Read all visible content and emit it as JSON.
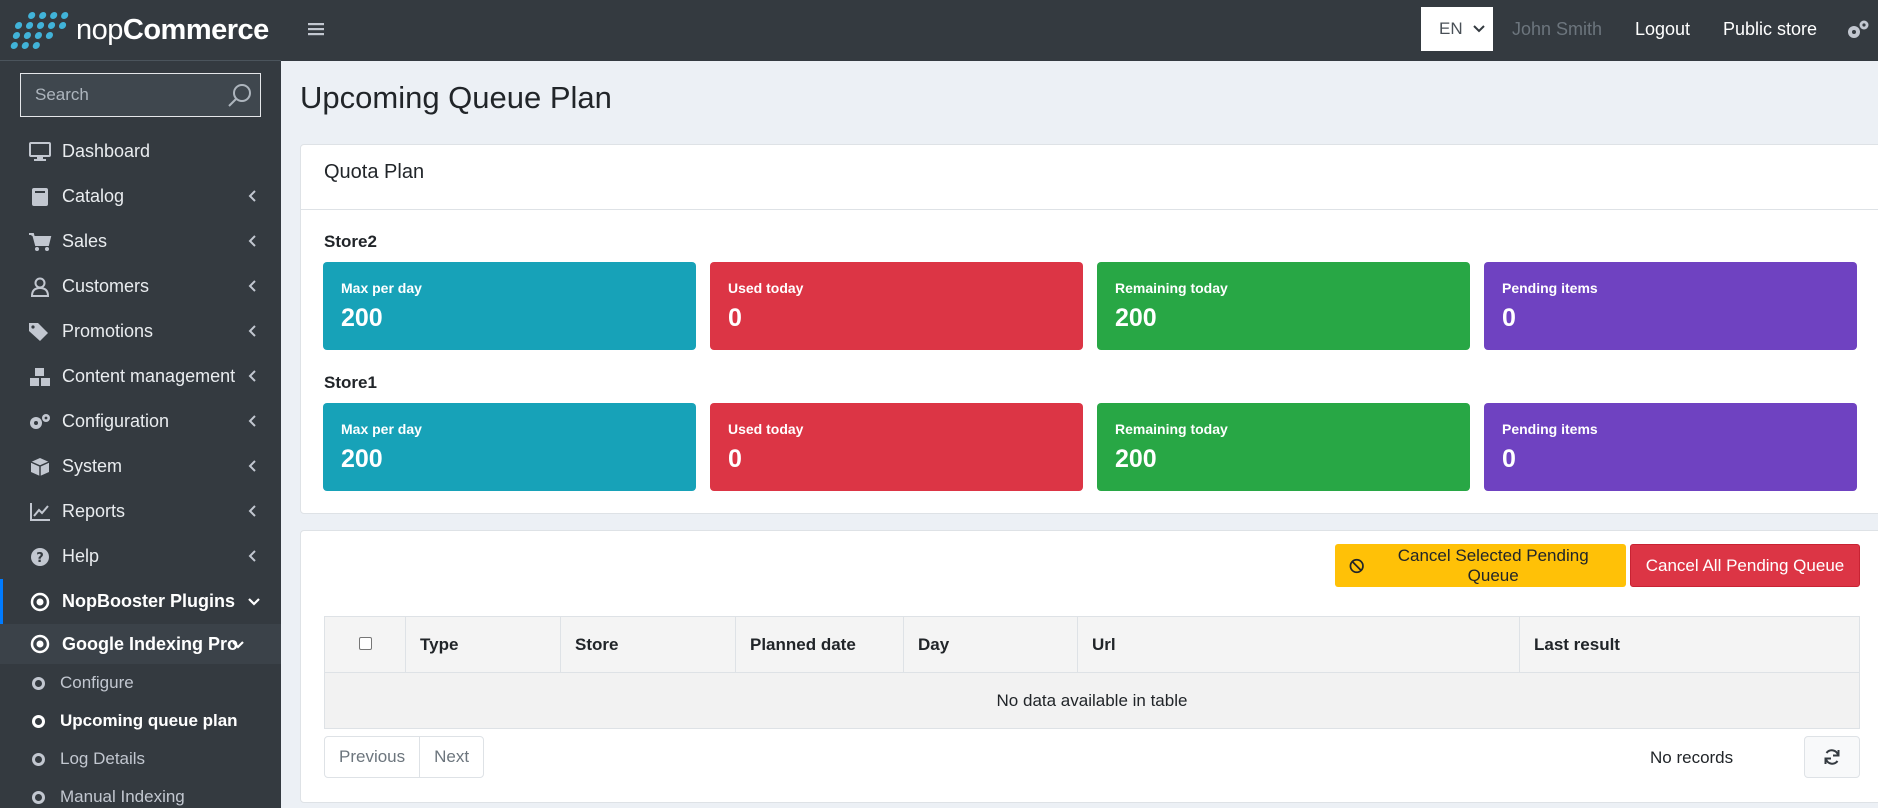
{
  "brand": {
    "name_light": "nop",
    "name_bold": "Commerce"
  },
  "search": {
    "placeholder": "Search"
  },
  "sidebar": {
    "items": [
      {
        "label": "Dashboard",
        "icon": "desktop-icon"
      },
      {
        "label": "Catalog",
        "icon": "book-icon"
      },
      {
        "label": "Sales",
        "icon": "cart-icon"
      },
      {
        "label": "Customers",
        "icon": "user-icon"
      },
      {
        "label": "Promotions",
        "icon": "tags-icon"
      },
      {
        "label": "Content management",
        "icon": "cubes-icon"
      },
      {
        "label": "Configuration",
        "icon": "gears-icon"
      },
      {
        "label": "System",
        "icon": "cube-icon"
      },
      {
        "label": "Reports",
        "icon": "chart-icon"
      },
      {
        "label": "Help",
        "icon": "question-icon"
      }
    ],
    "plugins_label": "NopBooster Plugins",
    "gip_label": "Google Indexing Pro",
    "sub_items": [
      {
        "label": "Configure"
      },
      {
        "label": "Upcoming queue plan"
      },
      {
        "label": "Log Details"
      },
      {
        "label": "Manual Indexing"
      }
    ]
  },
  "topbar": {
    "lang": "EN",
    "user": "John Smith",
    "logout": "Logout",
    "public_store": "Public store"
  },
  "page": {
    "title": "Upcoming Queue Plan"
  },
  "quota": {
    "header": "Quota Plan",
    "stores": [
      {
        "name": "Store2",
        "tiles": [
          {
            "label": "Max per day",
            "value": "200"
          },
          {
            "label": "Used today",
            "value": "0"
          },
          {
            "label": "Remaining today",
            "value": "200"
          },
          {
            "label": "Pending items",
            "value": "0"
          }
        ]
      },
      {
        "name": "Store1",
        "tiles": [
          {
            "label": "Max per day",
            "value": "200"
          },
          {
            "label": "Used today",
            "value": "0"
          },
          {
            "label": "Remaining today",
            "value": "200"
          },
          {
            "label": "Pending items",
            "value": "0"
          }
        ]
      }
    ]
  },
  "queue": {
    "cancel_selected": "Cancel Selected Pending Queue",
    "cancel_all": "Cancel All Pending Queue",
    "columns": [
      "Type",
      "Store",
      "Planned date",
      "Day",
      "Url",
      "Last result"
    ],
    "empty": "No data available in table",
    "previous": "Previous",
    "next": "Next",
    "no_records": "No records"
  },
  "colors": {
    "sidebar_bg": "#343a40",
    "accent_blue": "#007bff",
    "tile_cyan": "#17a2b8",
    "tile_red": "#dc3545",
    "tile_green": "#28a745",
    "tile_purple": "#6f42c1",
    "warning": "#ffc107"
  }
}
